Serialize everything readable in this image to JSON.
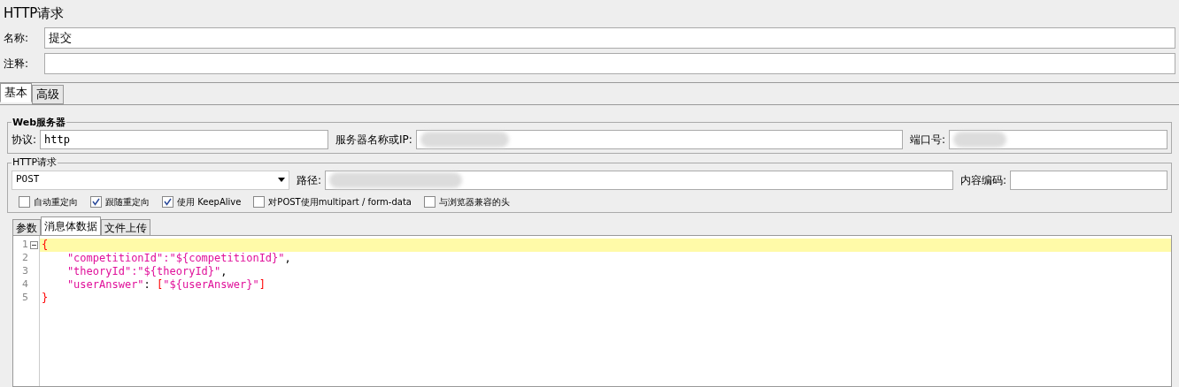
{
  "title": "HTTP请求",
  "name_field": {
    "label": "名称:",
    "value": "提交"
  },
  "comment_field": {
    "label": "注释:"
  },
  "tabs": [
    {
      "label": "基本",
      "selected": true
    },
    {
      "label": "高级",
      "selected": false
    }
  ],
  "web_server": {
    "legend": "Web服务器",
    "protocol_label": "协议:",
    "protocol_value": "http",
    "server_label": "服务器名称或IP:",
    "port_label": "端口号:"
  },
  "http_request": {
    "legend": "HTTP请求",
    "method": "POST",
    "path_label": "路径:",
    "encoding_label": "内容编码:",
    "options": [
      {
        "label": "自动重定向",
        "checked": false
      },
      {
        "label": "跟随重定向",
        "checked": true
      },
      {
        "label": "使用 KeepAlive",
        "checked": true
      },
      {
        "label": "对POST使用multipart / form-data",
        "checked": false
      },
      {
        "label": "与浏览器兼容的头",
        "checked": false
      }
    ]
  },
  "body_tabs": [
    {
      "label": "参数",
      "selected": false
    },
    {
      "label": "消息体数据",
      "selected": true
    },
    {
      "label": "文件上传",
      "selected": false
    }
  ],
  "code_lines": [
    {
      "number": "1",
      "current": true,
      "tokens": [
        {
          "kind": "bracket",
          "text": "{"
        }
      ]
    },
    {
      "number": "2",
      "current": false,
      "tokens": [
        {
          "kind": "string",
          "text": "    \"competitionId\":\"${competitionId}\""
        },
        {
          "kind": "punct",
          "text": ","
        }
      ]
    },
    {
      "number": "3",
      "current": false,
      "tokens": [
        {
          "kind": "string",
          "text": "    \"theoryId\":\"${theoryId}\""
        },
        {
          "kind": "punct",
          "text": ","
        }
      ]
    },
    {
      "number": "4",
      "current": false,
      "tokens": [
        {
          "kind": "string",
          "text": "    \"userAnswer\""
        },
        {
          "kind": "punct",
          "text": ": "
        },
        {
          "kind": "bracket",
          "text": "["
        },
        {
          "kind": "string",
          "text": "\"${userAnswer}\""
        },
        {
          "kind": "bracket",
          "text": "]"
        }
      ]
    },
    {
      "number": "5",
      "current": false,
      "tokens": [
        {
          "kind": "bracket",
          "text": "}"
        }
      ]
    }
  ]
}
